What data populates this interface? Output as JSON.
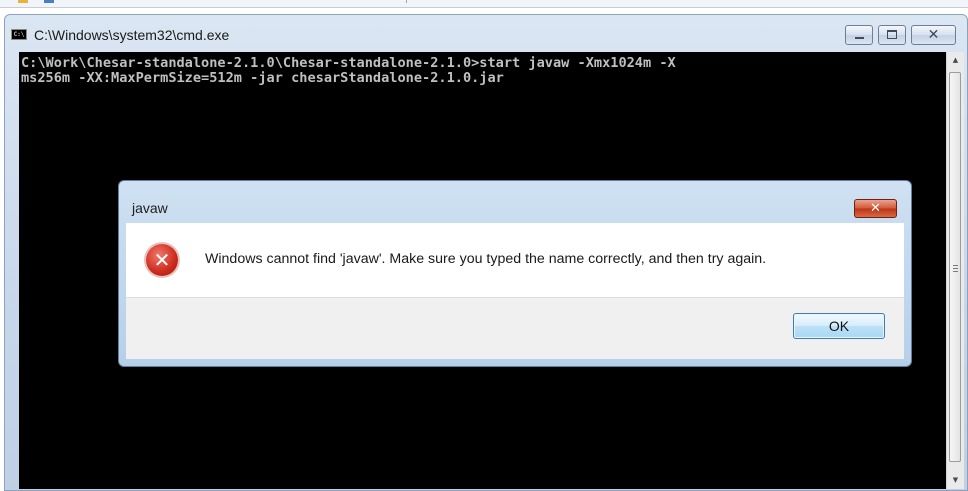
{
  "cmd_window": {
    "title": "C:\\Windows\\system32\\cmd.exe",
    "icon_label": "C:\\",
    "console_lines": [
      "C:\\Work\\Chesar-standalone-2.1.0\\Chesar-standalone-2.1.0>start javaw -Xmx1024m -X",
      "ms256m -XX:MaxPermSize=512m -jar chesarStandalone-2.1.0.jar"
    ],
    "buttons": {
      "minimize": "minimize",
      "maximize": "maximize",
      "close": "close"
    }
  },
  "dialog": {
    "title": "javaw",
    "message": "Windows cannot find 'javaw'. Make sure you typed the name correctly, and then try again.",
    "ok_label": "OK"
  },
  "icons": {
    "cmd": "cmd-window-icon",
    "error": "error-x-icon",
    "close": "close-icon",
    "minimize": "minimize-icon",
    "maximize": "maximize-icon",
    "scroll_up": "arrow-up-icon",
    "scroll_down": "arrow-down-icon"
  },
  "colors": {
    "console_bg": "#000000",
    "console_text": "#c0c0c0",
    "close_button": "#c7411e",
    "error_icon": "#cc2a1d"
  }
}
